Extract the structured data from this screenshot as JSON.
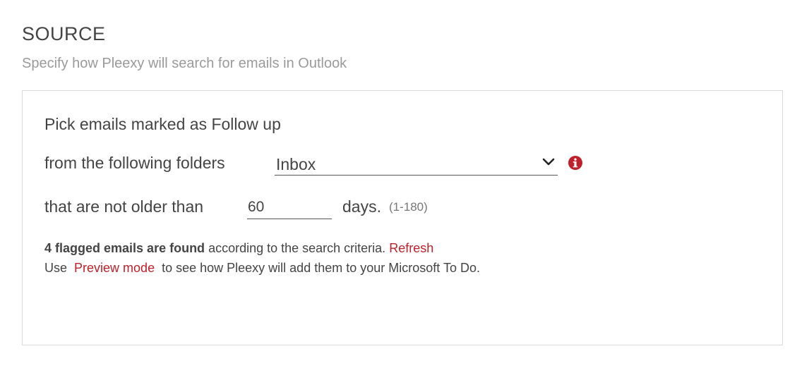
{
  "header": {
    "title": "SOURCE",
    "subtitle": "Specify how Pleexy will search for emails in Outlook"
  },
  "form": {
    "line1": "Pick emails marked as Follow up",
    "folders_label": "from the following folders",
    "folder_selected": "Inbox",
    "age_label": "that are not older than",
    "days_value": "60",
    "days_label": "days.",
    "days_range": "(1-180)"
  },
  "results": {
    "found_bold": "4 flagged emails are found",
    "found_rest": " according to the search criteria.",
    "refresh_link": "Refresh",
    "use_prefix": "Use",
    "preview_link": "Preview mode",
    "use_suffix": "to see how Pleexy will add them to your Microsoft To Do."
  },
  "icons": {
    "chevron": "chevron-down-icon",
    "info": "info-icon"
  },
  "colors": {
    "accent": "#c0202a",
    "text": "#444444",
    "muted": "#9a9a9a",
    "border": "#d9d9d9"
  }
}
